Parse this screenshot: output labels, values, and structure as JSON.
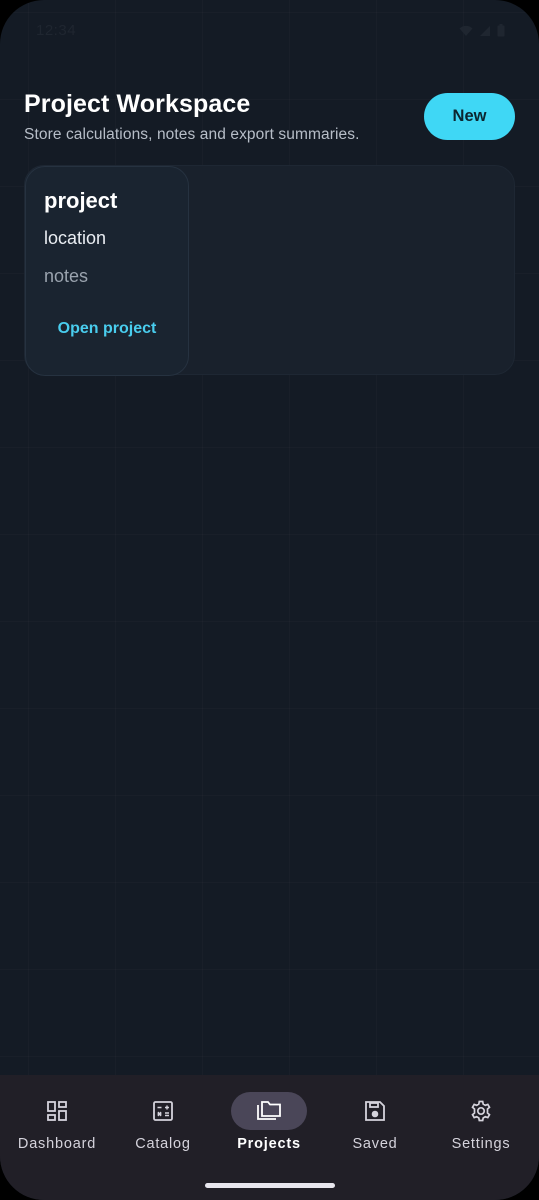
{
  "status_bar": {
    "time": "12:34"
  },
  "header": {
    "title": "Project Workspace",
    "subtitle": "Store calculations, notes and export summaries.",
    "new_button_label": "New"
  },
  "projects": [
    {
      "name": "project",
      "location": "location",
      "notes": "notes",
      "action_label": "Open project"
    }
  ],
  "bottom_nav": {
    "active": "Projects",
    "items": [
      {
        "label": "Dashboard",
        "icon": "dashboard-grid-icon"
      },
      {
        "label": "Catalog",
        "icon": "calculator-icon"
      },
      {
        "label": "Projects",
        "icon": "folders-icon"
      },
      {
        "label": "Saved",
        "icon": "floppy-disk-icon"
      },
      {
        "label": "Settings",
        "icon": "gear-icon"
      }
    ]
  },
  "colors": {
    "background": "#141b25",
    "accent": "#3fd7f5",
    "link": "#49cdee",
    "nav_background": "#211f27",
    "nav_active_pill": "#4a4658"
  }
}
